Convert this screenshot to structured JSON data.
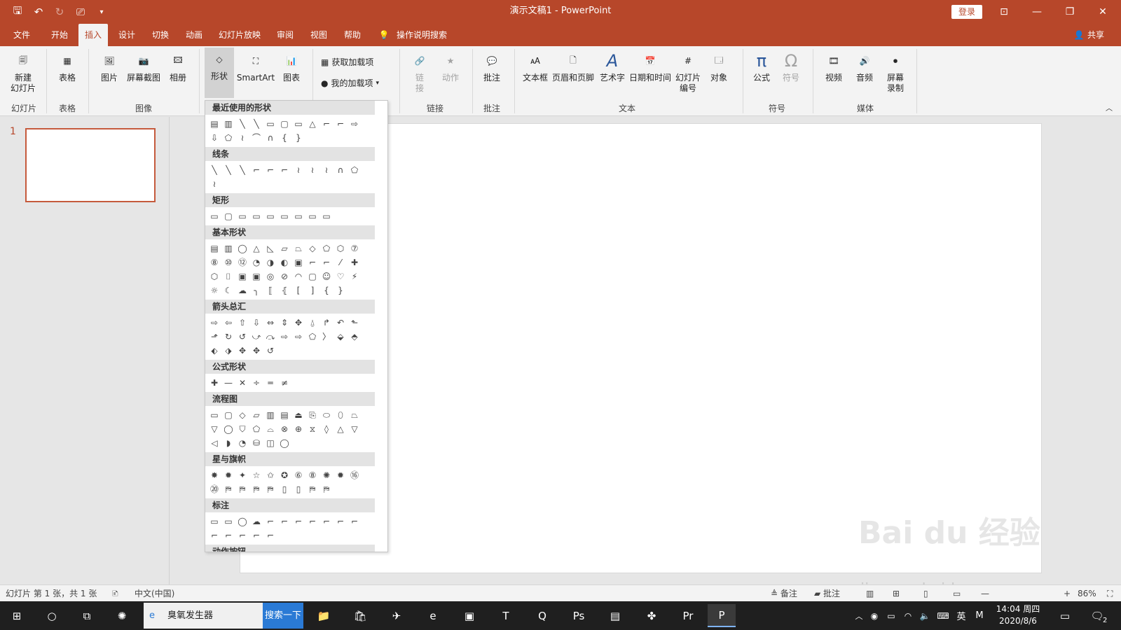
{
  "app": {
    "title": "演示文稿1 - PowerPoint",
    "login": "登录"
  },
  "menu": {
    "tabs": [
      "文件",
      "开始",
      "插入",
      "设计",
      "切换",
      "动画",
      "幻灯片放映",
      "审阅",
      "视图",
      "帮助"
    ],
    "active": "插入",
    "tellme": "操作说明搜索",
    "share": "共享"
  },
  "ribbon": {
    "buttons": {
      "new_slide": "新建\n幻灯片",
      "table": "表格",
      "picture": "图片",
      "screenshot": "屏幕截图",
      "album": "相册",
      "shapes": "形状",
      "smartart": "SmartArt",
      "chart": "图表",
      "get_addins": "获取加载项",
      "my_addins": "我的加载项",
      "link": "链\n接",
      "action": "动作",
      "comment": "批注",
      "textbox": "文本框",
      "header_footer": "页眉和页脚",
      "wordart": "艺术字",
      "datetime": "日期和时间",
      "slide_number": "幻灯片\n编号",
      "object": "对象",
      "equation": "公式",
      "symbol": "符号",
      "video": "视频",
      "audio": "音频",
      "screen_record": "屏幕\n录制"
    },
    "groups": {
      "slides": "幻灯片",
      "tables": "表格",
      "images": "图像",
      "links": "链接",
      "comments": "批注",
      "text": "文本",
      "symbols": "符号",
      "media": "媒体"
    }
  },
  "shapes_gallery": {
    "categories": [
      {
        "title": "最近使用的形状",
        "shapes": [
          "▤",
          "▥",
          "╲",
          "╲",
          "▭",
          "▢",
          "▭",
          "△",
          "⌐",
          "⌐",
          "⇨",
          "⇩",
          "⬠",
          "≀",
          "⌒",
          "∩",
          "{",
          "}"
        ]
      },
      {
        "title": "线条",
        "shapes": [
          "╲",
          "╲",
          "╲",
          "⌐",
          "⌐",
          "⌐",
          "≀",
          "≀",
          "≀",
          "∩",
          "⬠",
          "≀"
        ]
      },
      {
        "title": "矩形",
        "shapes": [
          "▭",
          "▢",
          "▭",
          "▭",
          "▭",
          "▭",
          "▭",
          "▭",
          "▭"
        ]
      },
      {
        "title": "基本形状",
        "shapes": [
          "▤",
          "▥",
          "◯",
          "△",
          "◺",
          "▱",
          "⏢",
          "◇",
          "⬠",
          "⬡",
          "⑦",
          "⑧",
          "⑩",
          "⑫",
          "◔",
          "◑",
          "◐",
          "▣",
          "⌐",
          "⌐",
          "⁄",
          "✚",
          "⬡",
          "⌷",
          "▣",
          "▣",
          "◎",
          "⊘",
          "◠",
          "▢",
          "☺",
          "♡",
          "⚡",
          "☼",
          "☾",
          "☁",
          "╮",
          "⟦",
          "⦃",
          "[",
          "]",
          "{",
          "}"
        ]
      },
      {
        "title": "箭头总汇",
        "shapes": [
          "⇨",
          "⇦",
          "⇧",
          "⇩",
          "⇔",
          "⇕",
          "✥",
          "⍙",
          "↱",
          "↶",
          "⬑",
          "⬏",
          "↻",
          "↺",
          "⤻",
          "⤼",
          "⇨",
          "⇨",
          "⬠",
          "〉",
          "⬙",
          "⬘",
          "⬖",
          "⬗",
          "✥",
          "✥",
          "↺"
        ]
      },
      {
        "title": "公式形状",
        "shapes": [
          "✚",
          "—",
          "✕",
          "÷",
          "═",
          "≠"
        ]
      },
      {
        "title": "流程图",
        "shapes": [
          "▭",
          "▢",
          "◇",
          "▱",
          "▥",
          "▤",
          "⏏",
          "⎘",
          "⬭",
          "⬯",
          "⏢",
          "▽",
          "◯",
          "⛉",
          "⬠",
          "⌓",
          "⊗",
          "⊕",
          "⧖",
          "◊",
          "△",
          "▽",
          "◁",
          "◗",
          "◔",
          "⛁",
          "◫",
          "◯"
        ]
      },
      {
        "title": "星与旗帜",
        "shapes": [
          "✸",
          "✹",
          "✦",
          "☆",
          "✩",
          "✪",
          "⑥",
          "⑧",
          "✺",
          "✹",
          "⑯",
          "⑳",
          "⛿",
          "⛿",
          "⛿",
          "⛿",
          "▯",
          "▯",
          "⛿",
          "⛿"
        ]
      },
      {
        "title": "标注",
        "shapes": [
          "▭",
          "▭",
          "◯",
          "☁",
          "⌐",
          "⌐",
          "⌐",
          "⌐",
          "⌐",
          "⌐",
          "⌐",
          "⌐",
          "⌐",
          "⌐",
          "⌐",
          "⌐"
        ]
      },
      {
        "title": "动作按钮",
        "shapes": [
          "◁",
          "▷",
          "⏮",
          "⏭",
          "⌂",
          "ⓘ",
          "↩",
          "▣",
          "▯",
          "◁",
          "?",
          "□"
        ]
      }
    ]
  },
  "slides": {
    "number": "1"
  },
  "status": {
    "slide_info": "幻灯片 第 1 张，共 1 张",
    "language": "中文(中国)",
    "notes": "备注",
    "comments": "批注",
    "zoom": "86%"
  },
  "taskbar": {
    "search_text": "臭氧发生器",
    "search_button": "搜索一下",
    "time": "14:04 周四",
    "date": "2020/8/6",
    "ime": "英",
    "notify_count": "2"
  },
  "watermark": {
    "text": "Bai du 经验",
    "url": "jingyan.baidu.com"
  }
}
